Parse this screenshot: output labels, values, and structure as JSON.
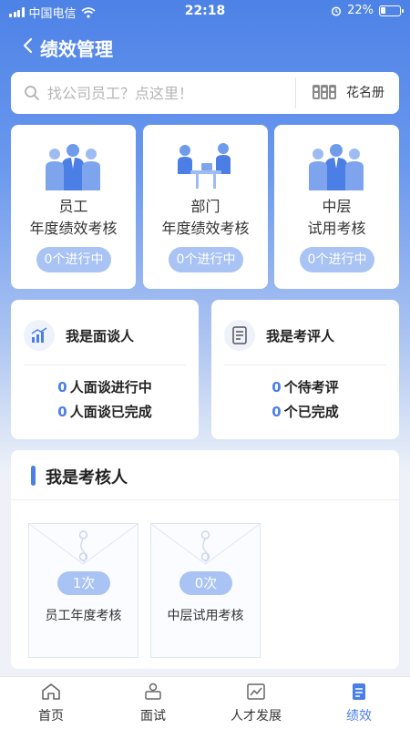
{
  "status": {
    "carrier": "中国电信",
    "time": "22:18",
    "battery": "22%"
  },
  "nav": {
    "title": "绩效管理"
  },
  "search": {
    "placeholder": "找公司员工？点这里！",
    "roster_label": "花名册"
  },
  "top_cards": [
    {
      "line1": "员工",
      "line2": "年度绩效考核",
      "status": "0个进行中"
    },
    {
      "line1": "部门",
      "line2": "年度绩效考核",
      "status": "0个进行中"
    },
    {
      "line1": "中层",
      "line2": "试用考核",
      "status": "0个进行中"
    }
  ],
  "interviewer": {
    "title": "我是面谈人",
    "in_progress_count": "0",
    "in_progress_label": "人面谈进行中",
    "done_count": "0",
    "done_label": "人面谈已完成"
  },
  "reviewer": {
    "title": "我是考评人",
    "pending_count": "0",
    "pending_label": "个待考评",
    "done_count": "0",
    "done_label": "个已完成"
  },
  "assessor": {
    "title": "我是考核人",
    "items": [
      {
        "count": "1次",
        "label": "员工年度考核"
      },
      {
        "count": "0次",
        "label": "中层试用考核"
      }
    ]
  },
  "tabs": [
    {
      "label": "首页"
    },
    {
      "label": "面试"
    },
    {
      "label": "人才发展"
    },
    {
      "label": "绩效"
    }
  ],
  "colors": {
    "accent": "#4b7fe6",
    "pill": "#a8c3f4",
    "header_gradient_top": "#4d82e6"
  }
}
